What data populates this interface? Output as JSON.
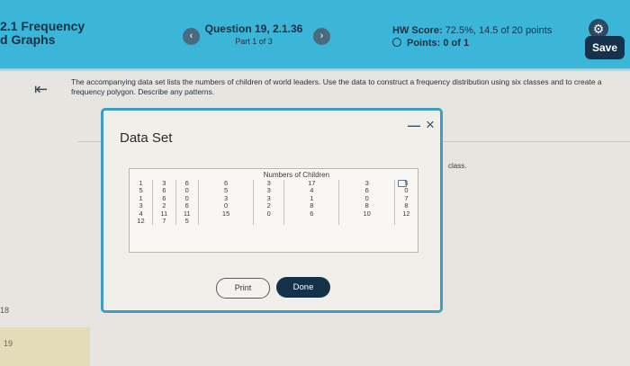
{
  "header": {
    "course_line1": "2.1 Frequency",
    "course_line2": "d Graphs",
    "question_title": "Question 19, 2.1.36",
    "question_part": "Part 1 of 3",
    "prev_icon": "chevron-left-icon",
    "next_icon": "chevron-right-icon",
    "hw_score_label": "HW Score:",
    "hw_score_value": "72.5%, 14.5 of 20 points",
    "points_label": "Points: 0 of 1",
    "save_label": "Save",
    "accent": "#3bb6d9"
  },
  "main": {
    "instructions": "The accompanying data set lists the numbers of children of world leaders. Use the data to construct a frequency distribution using six classes and to create a frequency polygon. Describe any patterns.",
    "side_text": "class."
  },
  "sidebar": {
    "item_18": "18",
    "item_19": "19"
  },
  "dialog": {
    "title": "Data Set",
    "table_header": "Numbers of Children",
    "columns": [
      [
        "1",
        "5",
        "1",
        "3",
        "4",
        "12"
      ],
      [
        "3",
        "6",
        "6",
        "2",
        "11",
        "7"
      ],
      [
        "6",
        "0",
        "0",
        "6",
        "11",
        "5"
      ],
      [
        "6",
        "5",
        "3",
        "0",
        "15",
        ""
      ],
      [
        "3",
        "3",
        "3",
        "2",
        "0",
        ""
      ],
      [
        "17",
        "4",
        "1",
        "8",
        "6",
        ""
      ],
      [
        "3",
        "6",
        "0",
        "8",
        "10",
        ""
      ],
      [
        "5",
        "0",
        "7",
        "8",
        "12",
        ""
      ]
    ],
    "print_label": "Print",
    "done_label": "Done"
  }
}
